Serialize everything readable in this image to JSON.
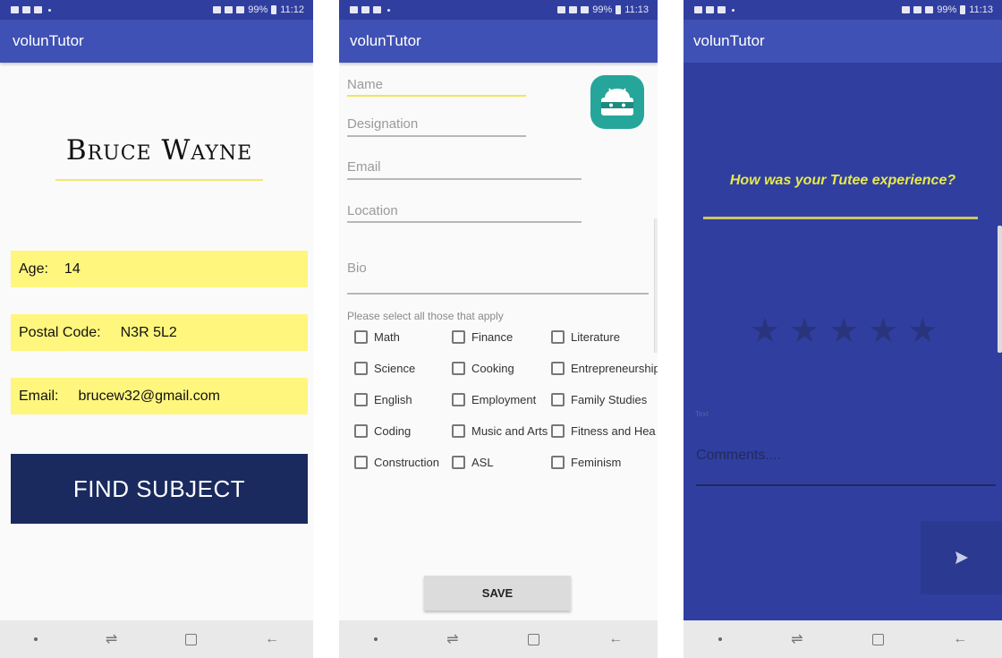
{
  "screens": [
    {
      "status": {
        "time": "11:12",
        "battery": "99%"
      },
      "app_title": "volunTutor",
      "profile": {
        "name": "Bruce Wayne",
        "age_label": "Age:",
        "age": "14",
        "postal_label": "Postal Code:",
        "postal": "N3R 5L2",
        "email_label": "Email:",
        "email": "brucew32@gmail.com"
      },
      "find_button": "FIND SUBJECT"
    },
    {
      "status": {
        "time": "11:13",
        "battery": "99%"
      },
      "app_title": "volunTutor",
      "form": {
        "name_placeholder": "Name",
        "designation_placeholder": "Designation",
        "email_placeholder": "Email",
        "location_placeholder": "Location",
        "bio_placeholder": "Bio",
        "select_note": "Please select all those that apply",
        "subjects": [
          "Math",
          "Finance",
          "Literature",
          "Science",
          "Cooking",
          "Entrepreneurship",
          "English",
          "Employment",
          "Family Studies",
          "Coding",
          "Music and Arts",
          "Fitness and Hea",
          "Construction",
          "ASL",
          "Feminism"
        ],
        "save_label": "SAVE"
      }
    },
    {
      "status": {
        "time": "11:13",
        "battery": "99%"
      },
      "app_title": "volunTutor",
      "feedback": {
        "question": "How was your Tutee experience?",
        "rating": 0,
        "rating_max": 5,
        "tiny_label": "Text",
        "comments_placeholder": "Comments...."
      }
    }
  ],
  "icons": [
    "status-icon",
    "android-icon",
    "star-icon",
    "send-icon",
    "nav-back-icon",
    "nav-home-icon",
    "nav-recent-icon"
  ],
  "colors": {
    "status_bar": "#303f9f",
    "app_bar": "#3f51b5",
    "yellow_field": "#fff67e",
    "find_button": "#1a2a5e",
    "screen3_bg": "#303f9f",
    "question_text": "#e7e94a",
    "android_icon": "#26a69a"
  }
}
